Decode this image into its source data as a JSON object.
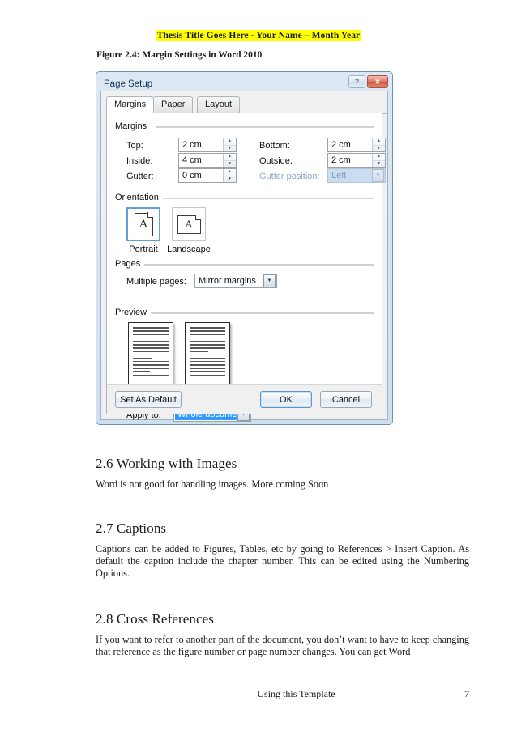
{
  "document": {
    "header": "Thesis Title Goes Here - Your Name – Month Year",
    "figure_caption": "Figure 2.4: Margin Settings in Word 2010",
    "sections": [
      {
        "heading": "2.6 Working with Images",
        "body": "Word is not good for handling images.  More coming Soon"
      },
      {
        "heading": "2.7 Captions",
        "body": "Captions can be added to Figures, Tables, etc by going to References > Insert Caption. As default the caption include the chapter number. This can be edited using the Numbering Options."
      },
      {
        "heading": "2.8 Cross References",
        "body": "If you want to refer to another part of the document, you don’t want to have to keep changing that reference as the figure number or page number changes. You can get Word"
      }
    ],
    "footer": {
      "center": "Using this Template",
      "page_number": "7"
    }
  },
  "dialog": {
    "title": "Page Setup",
    "title_buttons": {
      "help": "?",
      "close": "✕"
    },
    "tabs": [
      {
        "label": "Margins",
        "active": true
      },
      {
        "label": "Paper",
        "active": false
      },
      {
        "label": "Layout",
        "active": false
      }
    ],
    "margins_group": {
      "label": "Margins",
      "fields": [
        {
          "label": "Top:",
          "value": "2 cm"
        },
        {
          "label": "Bottom:",
          "value": "2 cm"
        },
        {
          "label": "Inside:",
          "value": "4 cm"
        },
        {
          "label": "Outside:",
          "value": "2 cm"
        },
        {
          "label": "Gutter:",
          "value": "0 cm"
        }
      ],
      "gutter_position": {
        "label": "Gutter position:",
        "value": "Left",
        "disabled": true
      }
    },
    "orientation_group": {
      "label": "Orientation",
      "options": [
        {
          "label": "Portrait",
          "selected": true,
          "glyph": "A"
        },
        {
          "label": "Landscape",
          "selected": false,
          "glyph": "A"
        }
      ]
    },
    "pages_group": {
      "label": "Pages",
      "multiple_pages": {
        "label": "Multiple pages:",
        "value": "Mirror margins"
      }
    },
    "preview_group": {
      "label": "Preview"
    },
    "apply_to": {
      "label": "Apply to:",
      "value": "Whole document"
    },
    "buttons": {
      "set_as_default": "Set As Default",
      "ok": "OK",
      "cancel": "Cancel"
    },
    "colors": {
      "accent": "#3399ff",
      "close_red": "#cf5436",
      "disabled_text": "#7f9fc2",
      "highlight_yellow": "#ffff00"
    }
  }
}
